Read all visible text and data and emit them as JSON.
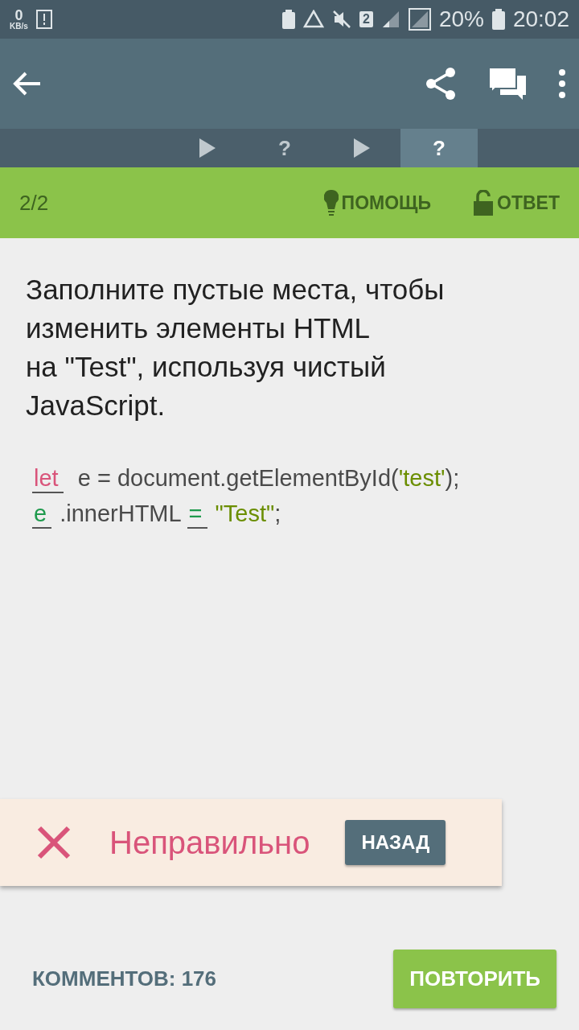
{
  "status_bar": {
    "speed": "0",
    "speed_unit": "KB/s",
    "sim": "2",
    "battery": "20%",
    "time": "20:02"
  },
  "steps": [
    {
      "kind": "lesson",
      "selected": false
    },
    {
      "kind": "quiz",
      "label": "?",
      "selected": false
    },
    {
      "kind": "lesson",
      "selected": false
    },
    {
      "kind": "quiz",
      "label": "?",
      "selected": true
    }
  ],
  "quiz_bar": {
    "progress": "2/2",
    "hint": "ПОМОЩЬ",
    "answer": "ОТВЕТ"
  },
  "question": "Заполните пустые места, чтобы изменить элементы HTML\nна \"Test\", используя чистый JavaScript.",
  "code": [
    [
      {
        "kind": "blank",
        "text": "let",
        "correct": false
      },
      {
        "kind": "plain",
        "text": " e = document.getElementById("
      },
      {
        "kind": "string",
        "text": "'test'"
      },
      {
        "kind": "plain",
        "text": ");"
      }
    ],
    [
      {
        "kind": "blank",
        "text": "e",
        "correct": true
      },
      {
        "kind": "plain",
        "text": ".innerHTML "
      },
      {
        "kind": "blank",
        "text": "=",
        "correct": true
      },
      {
        "kind": "string",
        "text": "\"Test\""
      },
      {
        "kind": "plain",
        "text": ";"
      }
    ]
  ],
  "result": {
    "text": "Неправильно",
    "button": "НАЗАД"
  },
  "footer": {
    "comments": "КОММЕНТОВ: 176",
    "retry": "ПОВТОРИТЬ"
  }
}
